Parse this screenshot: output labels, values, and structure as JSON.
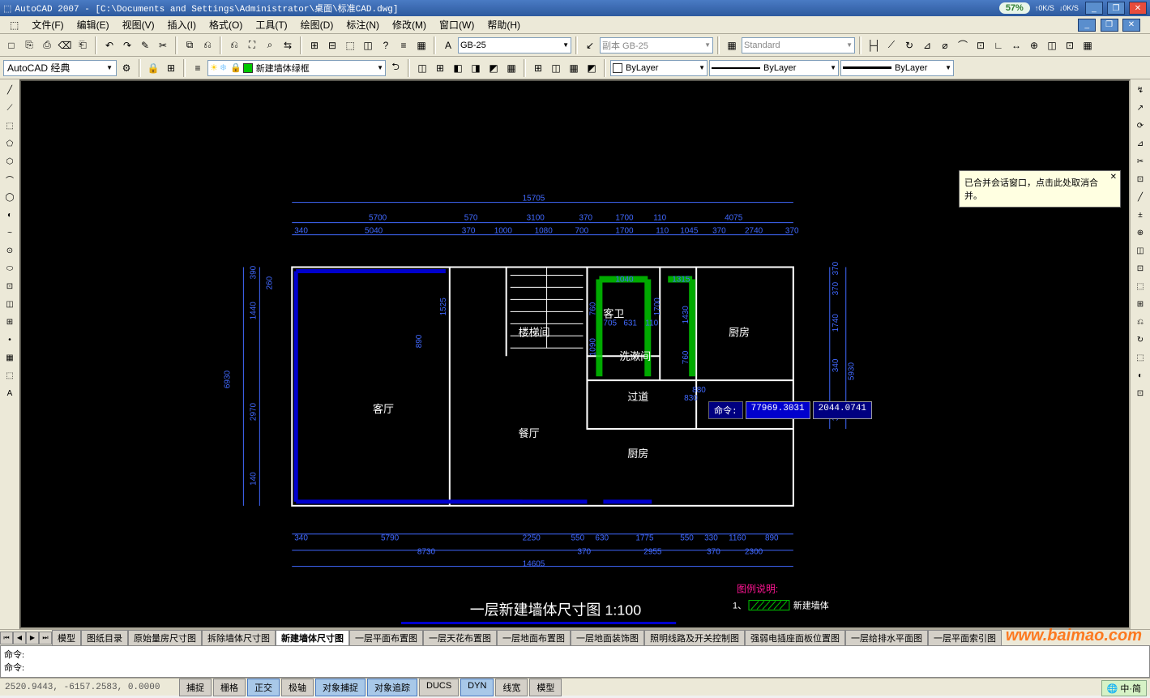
{
  "title": {
    "app": "AutoCAD 2007",
    "file": "[C:\\Documents and Settings\\Administrator\\桌面\\标准CAD.dwg]",
    "speed_pct": "57%",
    "speed_up": "0K/S",
    "speed_dn": "0K/S"
  },
  "window_controls": {
    "min": "_",
    "max": "❐",
    "close": "✕"
  },
  "menu": [
    "文件(F)",
    "编辑(E)",
    "视图(V)",
    "插入(I)",
    "格式(O)",
    "工具(T)",
    "绘图(D)",
    "标注(N)",
    "修改(M)",
    "窗口(W)",
    "帮助(H)"
  ],
  "toolbar1": {
    "workspace": "AutoCAD 经典",
    "icons1": [
      "□",
      "⎘",
      "⎙",
      "⌫",
      "⎗",
      "↶",
      "↷",
      "✎",
      "✂",
      "⧉",
      "⎌",
      "⎌",
      "⛶",
      "⌕",
      "⇆",
      "⊞",
      "⊟",
      "⬚",
      "◫",
      "?",
      "≡",
      "▦",
      "▤"
    ],
    "textstyle_icon": "A",
    "textstyle": "GB-25",
    "dimstyle_label": "副本 GB-25",
    "tablestyle": "Standard",
    "measure_icons": [
      "├┤",
      "⟋",
      "↻",
      "⊿",
      "⌀",
      "⌒",
      "⊡",
      "∟",
      "↔",
      "⊕",
      "◫",
      "⊡",
      "▦"
    ]
  },
  "toolbar2": {
    "layer_tools_icons": [
      "≡",
      "❄",
      "☀",
      "◐",
      "⬚",
      "🔒"
    ],
    "layer_name": "新建墙体绿框",
    "sheet_icons": [
      "◫",
      "⊞",
      "◧",
      "◨",
      "◩",
      "▦"
    ],
    "align_icons": [
      "⊞",
      "◫",
      "▦",
      "◩"
    ],
    "color_label": "ByLayer",
    "linetype_label": "ByLayer",
    "lineweight_label": "ByLayer"
  },
  "tooltip": {
    "text": "已合并会话窗口，点击此处取消合并。",
    "close": "✕"
  },
  "dyn_input": {
    "label": "命令:",
    "val1": "77969.3031",
    "val2": "2044.0741"
  },
  "drawing": {
    "plan_title": "一层新建墙体尺寸图  1:100",
    "rooms": {
      "keting": "客厅",
      "canting": "餐厅",
      "loutijian": "楼梯间",
      "kewei": "客卫",
      "xishujian": "洗漱间",
      "guodao": "过道",
      "chufang1": "厨房",
      "chufang2": "厨房"
    },
    "legend_title": "图例说明:",
    "legend1_num": "1、",
    "legend1_text": "新建墙体",
    "dims_top": {
      "total": "15705",
      "s1": "5700",
      "s2": "570",
      "s3": "3100",
      "s4": "370",
      "s5": "1700",
      "s6": "110",
      "s7": "4075"
    },
    "dims_top2": {
      "a": "340",
      "b": "5040",
      "c": "370",
      "d": "1000",
      "e": "1080",
      "f": "700",
      "g": "1700",
      "h": "110",
      "i": "1045",
      "j": "370",
      "k": "2740",
      "l": "370"
    },
    "dims_left": {
      "total": "6930",
      "a": "390",
      "b": "1440",
      "c": "2970",
      "d": "140",
      "e": "260"
    },
    "dims_mid": {
      "a": "1525",
      "b": "890"
    },
    "dims_right": {
      "a": "370",
      "b": "370",
      "c": "1740",
      "d": "340",
      "e": "5930",
      "f": "370"
    },
    "dims_int": {
      "a": "1040",
      "b": "705",
      "c": "631",
      "d": "110",
      "e": "1315",
      "f": "760",
      "g": "1700",
      "h": "1090",
      "i": "1430",
      "j": "760",
      "k": "880",
      "l": "830"
    },
    "dims_bot1": {
      "a": "340",
      "b": "5790",
      "c": "2250",
      "d": "550",
      "e": "630",
      "f": "1775",
      "g": "550",
      "h": "330",
      "i": "1160",
      "j": "890"
    },
    "dims_bot2": {
      "a": "8730",
      "b": "370",
      "c": "2955",
      "d": "370",
      "e": "2300"
    },
    "dims_bot3": {
      "total": "14605"
    }
  },
  "left_tools": [
    "╱",
    "⟋",
    "⬚",
    "⬠",
    "⬡",
    "⌒",
    "◯",
    "◐",
    "~",
    "⊙",
    "⬭",
    "⊡",
    "◫",
    "⊞",
    "•",
    "▦",
    "⬚",
    "A"
  ],
  "right_tools": [
    "↯",
    "↗",
    "⟳",
    "⊿",
    "✂",
    "⊡",
    "╱",
    "±",
    "⊕",
    "◫",
    "⊡",
    "⬚",
    "⊞",
    "⎌",
    "↻",
    "⬚",
    "◐",
    "⊡"
  ],
  "layout_tabs": {
    "nav": [
      "⏮",
      "◀",
      "▶",
      "⏭"
    ],
    "tabs": [
      "模型",
      "图纸目录",
      "原始量房尺寸图",
      "拆除墙体尺寸图",
      "新建墙体尺寸图",
      "一层平面布置图",
      "一层天花布置图",
      "一层地面布置图",
      "一层地面装饰图",
      "照明线路及开关控制图",
      "强弱电插座面板位置图",
      "一层给排水平面图",
      "一层平面索引图"
    ],
    "active_index": 4
  },
  "cmdline": {
    "line1": "命令:",
    "line2": "命令:"
  },
  "statusbar": {
    "coords": "2520.9443, -6157.2583, 0.0000",
    "modes": [
      "捕捉",
      "栅格",
      "正交",
      "极轴",
      "对象捕捉",
      "对象追踪",
      "DUCS",
      "DYN",
      "线宽",
      "模型"
    ],
    "active": [
      2,
      4,
      5,
      7
    ]
  },
  "ime": {
    "text": "中·简"
  },
  "watermark": "www.baimao.com"
}
